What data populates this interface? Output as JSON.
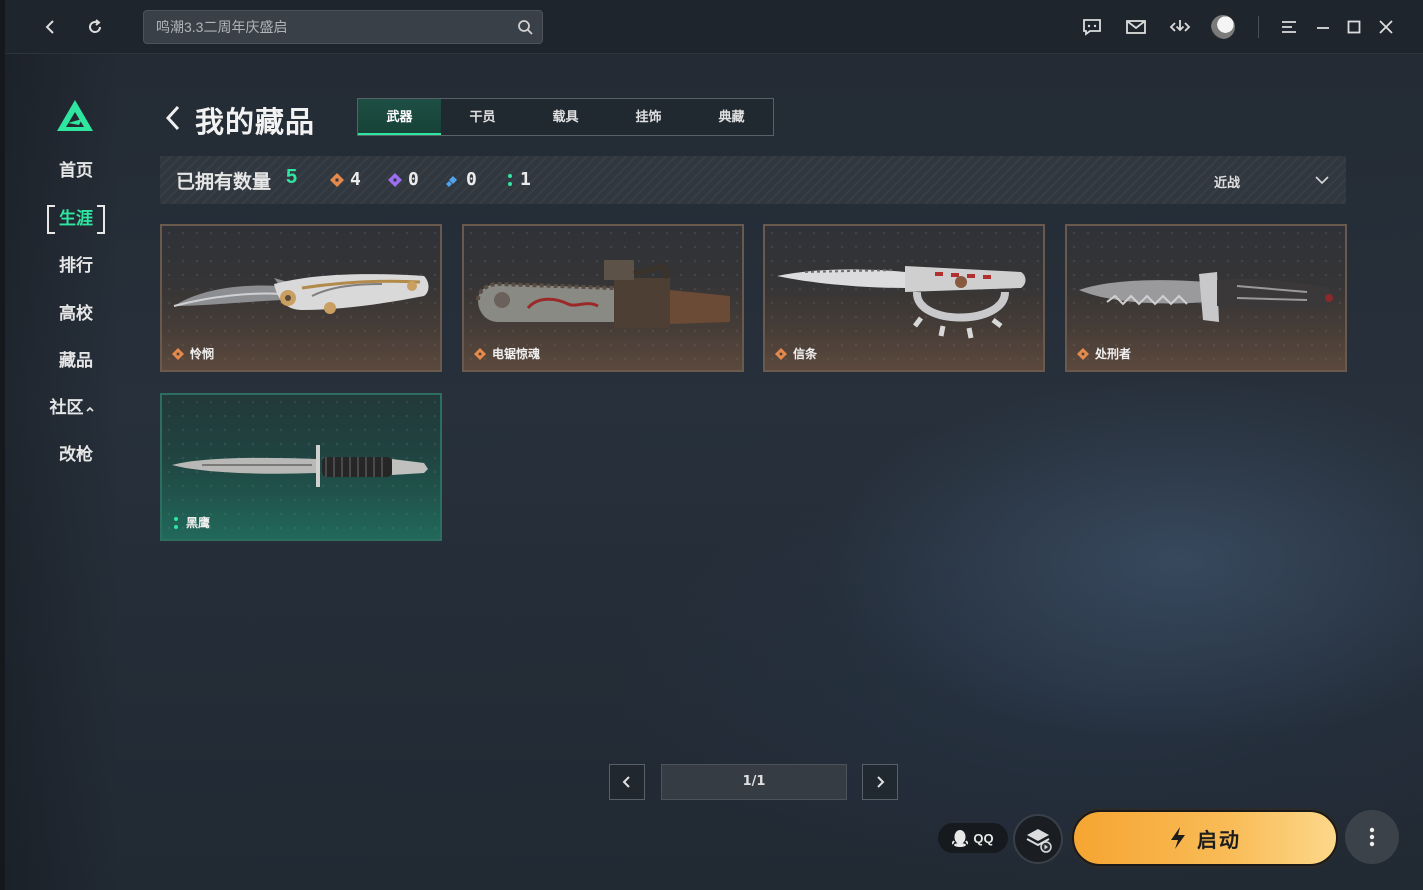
{
  "titlebar": {
    "search_placeholder": "鸣潮3.3二周年庆盛启",
    "icons": [
      "back-icon",
      "refresh-icon",
      "chat-icon",
      "mail-icon",
      "download-icon",
      "avatar",
      "menu-icon",
      "minimize-icon",
      "maximize-icon",
      "close-icon"
    ]
  },
  "sidebar": {
    "items": [
      {
        "label": "首页"
      },
      {
        "label": "生涯",
        "active": true
      },
      {
        "label": "排行"
      },
      {
        "label": "高校"
      },
      {
        "label": "藏品"
      },
      {
        "label": "社区"
      },
      {
        "label": "改枪"
      }
    ]
  },
  "header": {
    "title": "我的藏品",
    "tabs": [
      {
        "label": "武器",
        "active": true
      },
      {
        "label": "干员"
      },
      {
        "label": "载具"
      },
      {
        "label": "挂饰"
      },
      {
        "label": "典藏"
      }
    ]
  },
  "filter": {
    "owned_label": "已拥有数量",
    "owned_count": "5",
    "rarity_counts": [
      {
        "icon": "orange-diamond-icon",
        "color": "#e58a4a",
        "count": "4"
      },
      {
        "icon": "purple-diamond-icon",
        "color": "#9b6ff0",
        "count": "0"
      },
      {
        "icon": "blue-diamond-icon",
        "color": "#4fa3ec",
        "count": "0"
      },
      {
        "icon": "green-dots-icon",
        "color": "#2ee6a0",
        "count": "1"
      }
    ],
    "sort_value": "近战"
  },
  "items": [
    {
      "name": "怜悯",
      "rarity": "orange",
      "weapon_icon": "folding-knife"
    },
    {
      "name": "电锯惊魂",
      "rarity": "orange",
      "weapon_icon": "chainsaw"
    },
    {
      "name": "信条",
      "rarity": "orange",
      "weapon_icon": "knuckle-knife"
    },
    {
      "name": "处刑者",
      "rarity": "orange",
      "weapon_icon": "serrated-knife"
    },
    {
      "name": "黑鹰",
      "rarity": "green",
      "weapon_icon": "combat-dagger"
    }
  ],
  "pagination": {
    "page_text": "1/1"
  },
  "bottom": {
    "qq_label": "QQ",
    "launch_label": "启动"
  },
  "colors": {
    "accent_green": "#2ee6a0",
    "launch_orange": "#f6a531",
    "rarity_orange": "#e58a4a"
  }
}
